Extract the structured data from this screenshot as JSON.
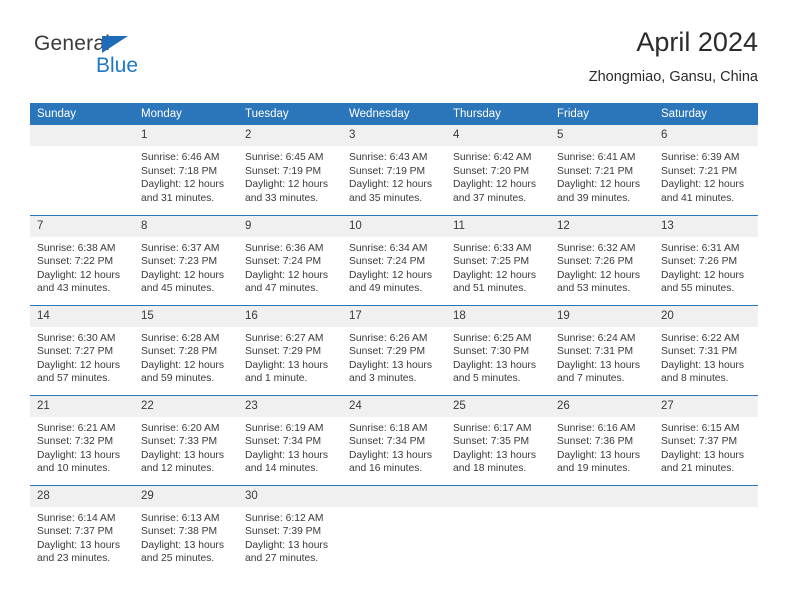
{
  "brand": {
    "name_part1": "General",
    "name_part2": "Blue",
    "accent_color": "#2079c4",
    "triangle_color": "#1e6bb8"
  },
  "header": {
    "title": "April 2024",
    "subtitle": "Zhongmiao, Gansu, China"
  },
  "theme": {
    "header_row_bg": "#2b76bb",
    "day_band_bg": "#f0f0f0",
    "row_border": "#2b76bb",
    "text": "#3a3a3a"
  },
  "calendar": {
    "weekday_headers": [
      "Sunday",
      "Monday",
      "Tuesday",
      "Wednesday",
      "Thursday",
      "Friday",
      "Saturday"
    ],
    "weeks": [
      [
        {
          "day": "",
          "sunrise": "",
          "sunset": "",
          "daylight_line1": "",
          "daylight_line2": ""
        },
        {
          "day": "1",
          "sunrise": "Sunrise: 6:46 AM",
          "sunset": "Sunset: 7:18 PM",
          "daylight_line1": "Daylight: 12 hours",
          "daylight_line2": "and 31 minutes."
        },
        {
          "day": "2",
          "sunrise": "Sunrise: 6:45 AM",
          "sunset": "Sunset: 7:19 PM",
          "daylight_line1": "Daylight: 12 hours",
          "daylight_line2": "and 33 minutes."
        },
        {
          "day": "3",
          "sunrise": "Sunrise: 6:43 AM",
          "sunset": "Sunset: 7:19 PM",
          "daylight_line1": "Daylight: 12 hours",
          "daylight_line2": "and 35 minutes."
        },
        {
          "day": "4",
          "sunrise": "Sunrise: 6:42 AM",
          "sunset": "Sunset: 7:20 PM",
          "daylight_line1": "Daylight: 12 hours",
          "daylight_line2": "and 37 minutes."
        },
        {
          "day": "5",
          "sunrise": "Sunrise: 6:41 AM",
          "sunset": "Sunset: 7:21 PM",
          "daylight_line1": "Daylight: 12 hours",
          "daylight_line2": "and 39 minutes."
        },
        {
          "day": "6",
          "sunrise": "Sunrise: 6:39 AM",
          "sunset": "Sunset: 7:21 PM",
          "daylight_line1": "Daylight: 12 hours",
          "daylight_line2": "and 41 minutes."
        }
      ],
      [
        {
          "day": "7",
          "sunrise": "Sunrise: 6:38 AM",
          "sunset": "Sunset: 7:22 PM",
          "daylight_line1": "Daylight: 12 hours",
          "daylight_line2": "and 43 minutes."
        },
        {
          "day": "8",
          "sunrise": "Sunrise: 6:37 AM",
          "sunset": "Sunset: 7:23 PM",
          "daylight_line1": "Daylight: 12 hours",
          "daylight_line2": "and 45 minutes."
        },
        {
          "day": "9",
          "sunrise": "Sunrise: 6:36 AM",
          "sunset": "Sunset: 7:24 PM",
          "daylight_line1": "Daylight: 12 hours",
          "daylight_line2": "and 47 minutes."
        },
        {
          "day": "10",
          "sunrise": "Sunrise: 6:34 AM",
          "sunset": "Sunset: 7:24 PM",
          "daylight_line1": "Daylight: 12 hours",
          "daylight_line2": "and 49 minutes."
        },
        {
          "day": "11",
          "sunrise": "Sunrise: 6:33 AM",
          "sunset": "Sunset: 7:25 PM",
          "daylight_line1": "Daylight: 12 hours",
          "daylight_line2": "and 51 minutes."
        },
        {
          "day": "12",
          "sunrise": "Sunrise: 6:32 AM",
          "sunset": "Sunset: 7:26 PM",
          "daylight_line1": "Daylight: 12 hours",
          "daylight_line2": "and 53 minutes."
        },
        {
          "day": "13",
          "sunrise": "Sunrise: 6:31 AM",
          "sunset": "Sunset: 7:26 PM",
          "daylight_line1": "Daylight: 12 hours",
          "daylight_line2": "and 55 minutes."
        }
      ],
      [
        {
          "day": "14",
          "sunrise": "Sunrise: 6:30 AM",
          "sunset": "Sunset: 7:27 PM",
          "daylight_line1": "Daylight: 12 hours",
          "daylight_line2": "and 57 minutes."
        },
        {
          "day": "15",
          "sunrise": "Sunrise: 6:28 AM",
          "sunset": "Sunset: 7:28 PM",
          "daylight_line1": "Daylight: 12 hours",
          "daylight_line2": "and 59 minutes."
        },
        {
          "day": "16",
          "sunrise": "Sunrise: 6:27 AM",
          "sunset": "Sunset: 7:29 PM",
          "daylight_line1": "Daylight: 13 hours",
          "daylight_line2": "and 1 minute."
        },
        {
          "day": "17",
          "sunrise": "Sunrise: 6:26 AM",
          "sunset": "Sunset: 7:29 PM",
          "daylight_line1": "Daylight: 13 hours",
          "daylight_line2": "and 3 minutes."
        },
        {
          "day": "18",
          "sunrise": "Sunrise: 6:25 AM",
          "sunset": "Sunset: 7:30 PM",
          "daylight_line1": "Daylight: 13 hours",
          "daylight_line2": "and 5 minutes."
        },
        {
          "day": "19",
          "sunrise": "Sunrise: 6:24 AM",
          "sunset": "Sunset: 7:31 PM",
          "daylight_line1": "Daylight: 13 hours",
          "daylight_line2": "and 7 minutes."
        },
        {
          "day": "20",
          "sunrise": "Sunrise: 6:22 AM",
          "sunset": "Sunset: 7:31 PM",
          "daylight_line1": "Daylight: 13 hours",
          "daylight_line2": "and 8 minutes."
        }
      ],
      [
        {
          "day": "21",
          "sunrise": "Sunrise: 6:21 AM",
          "sunset": "Sunset: 7:32 PM",
          "daylight_line1": "Daylight: 13 hours",
          "daylight_line2": "and 10 minutes."
        },
        {
          "day": "22",
          "sunrise": "Sunrise: 6:20 AM",
          "sunset": "Sunset: 7:33 PM",
          "daylight_line1": "Daylight: 13 hours",
          "daylight_line2": "and 12 minutes."
        },
        {
          "day": "23",
          "sunrise": "Sunrise: 6:19 AM",
          "sunset": "Sunset: 7:34 PM",
          "daylight_line1": "Daylight: 13 hours",
          "daylight_line2": "and 14 minutes."
        },
        {
          "day": "24",
          "sunrise": "Sunrise: 6:18 AM",
          "sunset": "Sunset: 7:34 PM",
          "daylight_line1": "Daylight: 13 hours",
          "daylight_line2": "and 16 minutes."
        },
        {
          "day": "25",
          "sunrise": "Sunrise: 6:17 AM",
          "sunset": "Sunset: 7:35 PM",
          "daylight_line1": "Daylight: 13 hours",
          "daylight_line2": "and 18 minutes."
        },
        {
          "day": "26",
          "sunrise": "Sunrise: 6:16 AM",
          "sunset": "Sunset: 7:36 PM",
          "daylight_line1": "Daylight: 13 hours",
          "daylight_line2": "and 19 minutes."
        },
        {
          "day": "27",
          "sunrise": "Sunrise: 6:15 AM",
          "sunset": "Sunset: 7:37 PM",
          "daylight_line1": "Daylight: 13 hours",
          "daylight_line2": "and 21 minutes."
        }
      ],
      [
        {
          "day": "28",
          "sunrise": "Sunrise: 6:14 AM",
          "sunset": "Sunset: 7:37 PM",
          "daylight_line1": "Daylight: 13 hours",
          "daylight_line2": "and 23 minutes."
        },
        {
          "day": "29",
          "sunrise": "Sunrise: 6:13 AM",
          "sunset": "Sunset: 7:38 PM",
          "daylight_line1": "Daylight: 13 hours",
          "daylight_line2": "and 25 minutes."
        },
        {
          "day": "30",
          "sunrise": "Sunrise: 6:12 AM",
          "sunset": "Sunset: 7:39 PM",
          "daylight_line1": "Daylight: 13 hours",
          "daylight_line2": "and 27 minutes."
        },
        {
          "day": "",
          "sunrise": "",
          "sunset": "",
          "daylight_line1": "",
          "daylight_line2": ""
        },
        {
          "day": "",
          "sunrise": "",
          "sunset": "",
          "daylight_line1": "",
          "daylight_line2": ""
        },
        {
          "day": "",
          "sunrise": "",
          "sunset": "",
          "daylight_line1": "",
          "daylight_line2": ""
        },
        {
          "day": "",
          "sunrise": "",
          "sunset": "",
          "daylight_line1": "",
          "daylight_line2": ""
        }
      ]
    ]
  }
}
